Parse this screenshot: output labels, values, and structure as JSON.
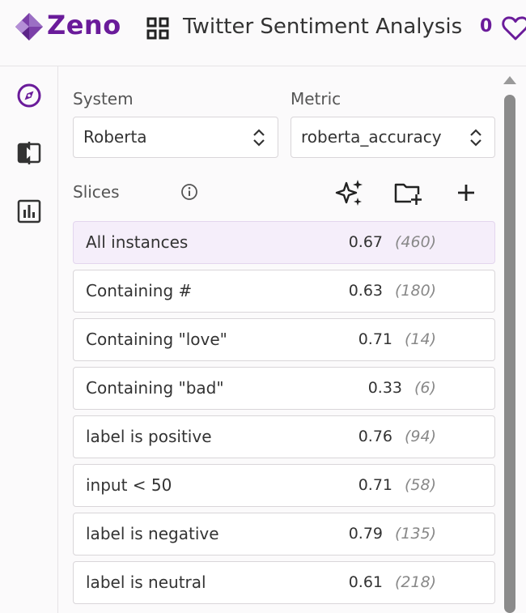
{
  "header": {
    "brand": "Zeno",
    "project_title": "Twitter Sentiment Analysis",
    "like_count": "0",
    "brand_color": "#6a1b9a"
  },
  "sidebar": {
    "items": [
      {
        "name": "explore",
        "icon": "compass-icon"
      },
      {
        "name": "compare",
        "icon": "compare-icon"
      },
      {
        "name": "chart",
        "icon": "bar-chart-icon"
      }
    ]
  },
  "main": {
    "system_label": "System",
    "system_value": "Roberta",
    "metric_label": "Metric",
    "metric_value": "roberta_accuracy",
    "slices_label": "Slices",
    "tools": [
      "sparkle-icon",
      "folder-plus-icon",
      "plus-icon"
    ],
    "slices": [
      {
        "name": "All instances",
        "metric": "0.67",
        "count": "(460)",
        "selected": true
      },
      {
        "name": "Containing #",
        "metric": "0.63",
        "count": "(180)"
      },
      {
        "name": "Containing \"love\"",
        "metric": "0.71",
        "count": "(14)"
      },
      {
        "name": "Containing \"bad\"",
        "metric": "0.33",
        "count": "(6)"
      },
      {
        "name": "label is positive",
        "metric": "0.76",
        "count": "(94)"
      },
      {
        "name": "input < 50",
        "metric": "0.71",
        "count": "(58)"
      },
      {
        "name": "label is negative",
        "metric": "0.79",
        "count": "(135)"
      },
      {
        "name": "label is neutral",
        "metric": "0.61",
        "count": "(218)"
      }
    ]
  }
}
